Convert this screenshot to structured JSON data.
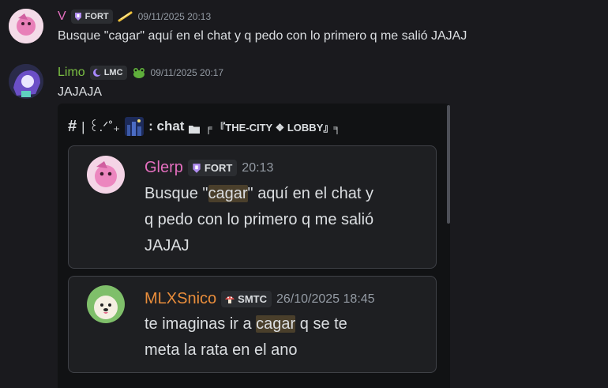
{
  "messages": [
    {
      "username": "V",
      "tag": "FORT",
      "timestamp": "09/11/2025 20:13",
      "text": "Busque \"cagar\" aquí en el chat y q pedo con lo primero q me salió JAJAJ",
      "colors": {
        "name": "#e46fbf"
      }
    },
    {
      "username": "Limo",
      "tag": "LMC",
      "timestamp": "09/11/2025 20:17",
      "text": "JAJAJA",
      "colors": {
        "name": "#7bc043"
      }
    }
  ],
  "forwarded": {
    "hash": "#",
    "channel_prefix": "| ꒰.ᐟ˚₊",
    "channel_name": ": chat",
    "channel_suffix": "╒ 『THE-CITY ❖ LOBBY』╕",
    "results": [
      {
        "username": "Glerp",
        "tag": "FORT",
        "timestamp": "20:13",
        "line1_before": "Busque \"",
        "line1_highlight": "cagar",
        "line1_after": "\" aquí en el chat y",
        "line2": "q pedo con lo primero q me salió",
        "line3": "JAJAJ",
        "name_color": "#e46fbf"
      },
      {
        "username": "MLXSnico",
        "tag": "SMTC",
        "timestamp": "26/10/2025 18:45",
        "line1_before": "te imaginas ir a ",
        "line1_highlight": "cagar",
        "line1_after": " q se te",
        "line2": "meta la rata en el ano",
        "name_color": "#e98d3b"
      }
    ]
  },
  "icons": {
    "tag_icon": "guild-tag-icon",
    "sparkle": "sparkle-sticker-icon",
    "frog": "frog-emoji-icon",
    "folder": "folder-icon"
  }
}
